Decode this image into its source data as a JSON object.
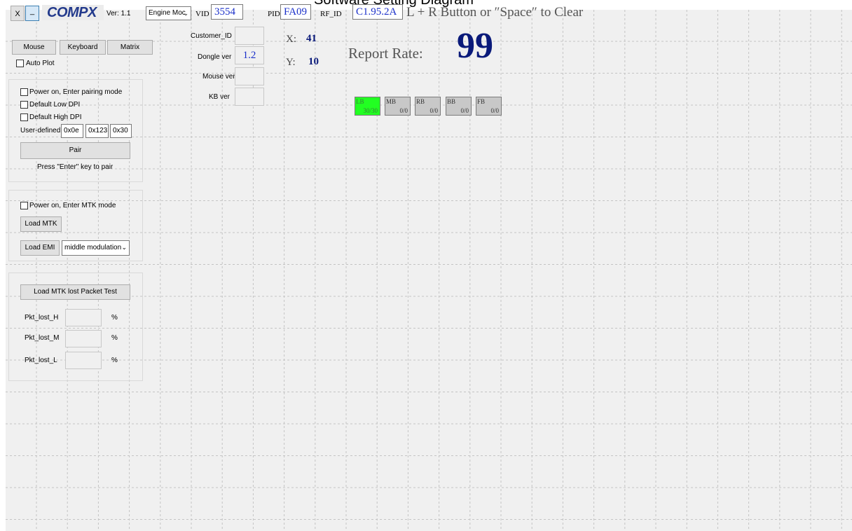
{
  "document_title": "Software Setting Diagram",
  "window": {
    "close_label": "X",
    "minimize_label": "_"
  },
  "logo": {
    "text": "COMPX"
  },
  "version_label": "Ver: 1.1",
  "mode_select": {
    "value": "Engine Moc"
  },
  "ids": {
    "vid": {
      "label": "VID",
      "value": "3554"
    },
    "pid": {
      "label": "PID",
      "value": "FA09"
    },
    "rf_id": {
      "label": "RF_ID",
      "value": "C1.95.2A"
    }
  },
  "hint": "L + R Button or ″Space″ to Clear",
  "tabs": [
    "Mouse",
    "Keyboard",
    "Matrix"
  ],
  "auto_plot_label": "Auto Plot",
  "pairing": {
    "power_on_pairing_label": "Power on, Enter pairing mode",
    "default_low_dpi_label": "Default Low DPI",
    "default_high_dpi_label": "Default High DPI",
    "user_defined_label": "User-defined",
    "user_defined_values": [
      "0x0e",
      "0x123",
      "0x30"
    ],
    "pair_button": "Pair",
    "pair_hint": "Press \"Enter\" key to pair"
  },
  "mtk": {
    "power_on_mtk_label": "Power on, Enter MTK mode",
    "load_mtk_button": "Load MTK",
    "load_emi_button": "Load EMI",
    "modulation_select": "middle modulation"
  },
  "packet_test": {
    "button": "Load MTK lost Packet Test",
    "rows": [
      {
        "label": "Pkt_lost_H",
        "unit": "%"
      },
      {
        "label": "Pkt_lost_M",
        "unit": "%"
      },
      {
        "label": "Pkt_lost_L",
        "unit": "%"
      }
    ]
  },
  "info": {
    "customer_id_label": "Customer_ID",
    "dongle_ver_label": "Dongle ver",
    "dongle_ver_value": "1.2",
    "mouse_ver_label": "Mouse ver",
    "kb_ver_label": "KB ver"
  },
  "coords": {
    "x_label": "X:",
    "x_value": "41",
    "y_label": "Y:",
    "y_value": "10"
  },
  "report_rate": {
    "label": "Report Rate:",
    "value": "99"
  },
  "buttons": [
    {
      "key": "LB",
      "count": "30/30",
      "active": true
    },
    {
      "key": "MB",
      "count": "0/0",
      "active": false
    },
    {
      "key": "RB",
      "count": "0/0",
      "active": false
    },
    {
      "key": "BB",
      "count": "0/0",
      "active": false
    },
    {
      "key": "FB",
      "count": "0/0",
      "active": false
    }
  ],
  "colors": {
    "active_button": "#22ff22",
    "inactive_button": "#c8c8c8",
    "value_blue": "#1a2fc9",
    "report_rate_navy": "#0a1a7a"
  }
}
